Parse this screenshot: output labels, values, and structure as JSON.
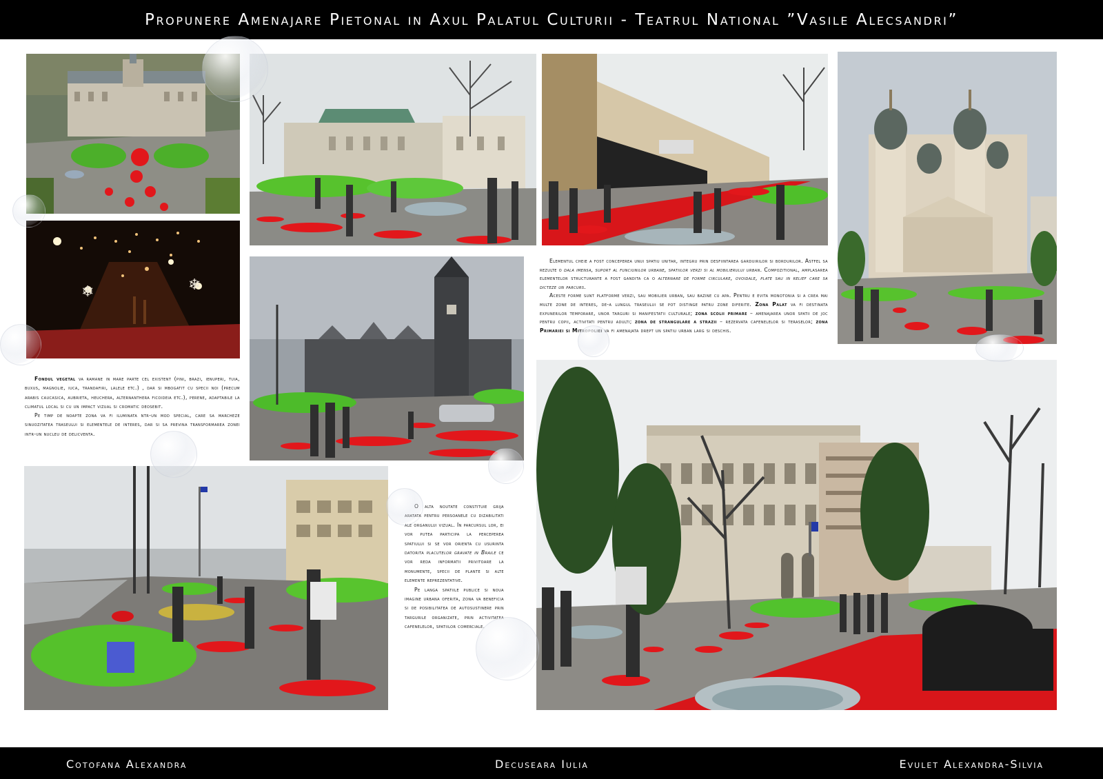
{
  "header": {
    "title": "Propunere Amenajare Pietonal in Axul Palatul Culturii - Teatrul National ”Vasile Alecsandri”"
  },
  "text_vegetation": {
    "p1_bold": "Fondul vegetal",
    "p1_rest": " va ramane in mare parte cel existent (pini, brazi, ienuperi, tuia, buxus, magnolie, iuca, trandafiri, lalele etc.) , dar si mbogatit cu specii noi (precum arabis caucasica, aubrieta, heuchera, alternanthera ficoideia etc.), perene, adaptabile la climatul local si cu un impact vizual si cromatic deosebit.",
    "p2": "Pe timp de noapte zona va fi iluminata ntr-un mod special, care sa marcheze sinuozitatea traseului si elementele de interes, dar si sa previna transformarea zonei intr-un nucleu de delicventa."
  },
  "text_concept": {
    "p1_a": "Elementul cheie a fost conceperea unui spatiu unitar, integru prin desfiintarea garduirilor si bordurilor. Astfel sa rezulte o ",
    "p1_b": "dala imensa, suport al funciunilor urbane, spatiilor verzi si al mobilierului urban",
    "p1_c": ". Compozitional, amplasarea elementelor structurante a fost gandita ca o ",
    "p1_d": "alternare de forme circulare, ovoidale, plate sau in relief care sa dicteze un parcurs.",
    "p2_a": "Aceste forme sunt platforme verzi, sau mobilier urban, sau bazine cu apa. Pentru e evita monotonia si a crea mai multe zone de interes, de-a lungul traseului se pot distinge patru zone diferite. ",
    "p2_zone1": "Zona Palat",
    "p2_b": " va fi destinata expunerilor temporare, unor targuri si manifestatii culturale;  ",
    "p2_zone2": "zona scolii primare",
    "p2_c": " – amenajarea unor spatii de joc pentru copii, activitati pentru adulti; ",
    "p2_zone3": "zona de strangulare a strazii",
    "p2_d": " – rezervata cafenelelor si teraselor;  ",
    "p2_zone4": "zona Primariei si Mitropoliei",
    "p2_e": " va fi amenajata drept un spatiu urban larg si deschis."
  },
  "text_accessibility": {
    "p1_a": "O alta noutate constituie grija aratata pentru persoanele cu dizabilitati ale organului vizual. In parcursul lor, ei vor putea participa la perceperea spatiului si se vor orienta cu usurinta datorita ",
    "p1_b": "placutelor gravate in Braile",
    "p1_c": " ce vor reda informatii privitoare la monumente, specii de plante si alte elemente reprezentative.",
    "p2": "Pe langa spatiile publice si noua imagine urbana oferita, zona va beneficia si de posibilitatea de autosustinere prin targurile organizate, prin activitatea cafenelelor, spatiilor comerciale."
  },
  "footer": {
    "author_left": "Cotofana Alexandra",
    "author_center": "Decuseara Iulia",
    "author_right": "Evulet Alexandra-Silvia"
  }
}
